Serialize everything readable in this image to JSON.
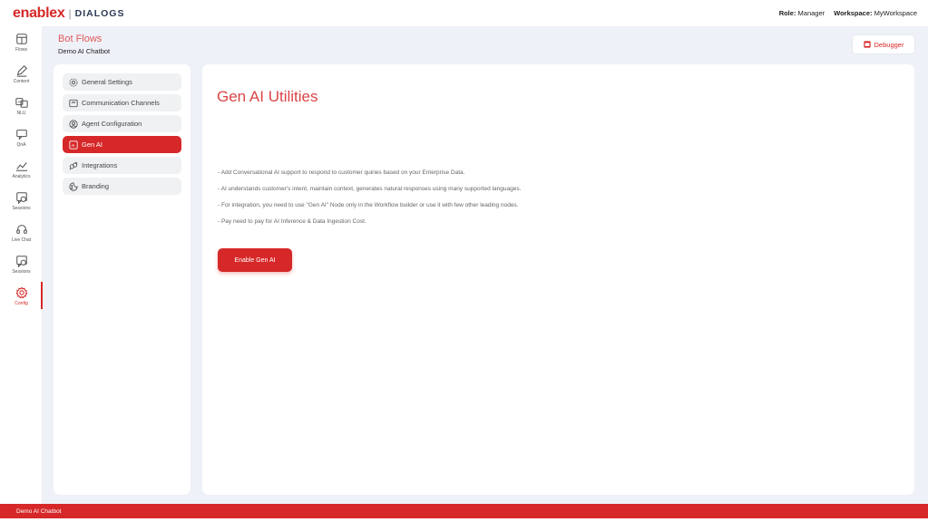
{
  "header": {
    "brand": "enablex",
    "separator": "|",
    "product": "DIALOGS",
    "role_label": "Role:",
    "role_value": "Manager",
    "workspace_label": "Workspace:",
    "workspace_value": "MyWorkspace"
  },
  "leftnav": {
    "items": [
      {
        "label": "Flows",
        "icon": "flows-icon"
      },
      {
        "label": "Content",
        "icon": "pen-icon"
      },
      {
        "label": "NLU",
        "icon": "nlu-icon"
      },
      {
        "label": "QnA",
        "icon": "qna-icon"
      },
      {
        "label": "Analytics",
        "icon": "analytics-icon"
      },
      {
        "label": "Sessions",
        "icon": "sessions-icon"
      },
      {
        "label": "Live Chat",
        "icon": "headset-icon"
      },
      {
        "label": "Sessions",
        "icon": "sessions-icon"
      },
      {
        "label": "Config",
        "icon": "gear-icon"
      }
    ],
    "active_index": 8
  },
  "page": {
    "title": "Bot Flows",
    "subtitle": "Demo AI Chatbot",
    "debugger_label": "Debugger"
  },
  "settings_menu": {
    "items": [
      {
        "label": "General Settings",
        "icon": "gear-icon"
      },
      {
        "label": "Communication Channels",
        "icon": "channels-icon"
      },
      {
        "label": "Agent Configuration",
        "icon": "agent-icon"
      },
      {
        "label": "Gen AI",
        "icon": "ai-icon"
      },
      {
        "label": "Integrations",
        "icon": "integrations-icon"
      },
      {
        "label": "Branding",
        "icon": "branding-icon"
      }
    ],
    "active_index": 3
  },
  "main": {
    "heading": "Gen AI Utilities",
    "bullets": [
      "- Add Conversational AI support to respond to customer quiries based on your Enterprise Data.",
      "- AI understands customer's intent, maintain context, generates natural responses using many supported languages.",
      "- For integration, you need to use \"Gen AI\" Node only in the Workflow builder or use it with few other leading nodes.",
      "- Pay need to pay for AI Inference & Data Ingestion Cost."
    ],
    "button_label": "Enable Gen AI"
  },
  "footer": {
    "text": "Demo AI Chatbot"
  },
  "colors": {
    "accent": "#d62828",
    "background": "#eef1f7"
  }
}
